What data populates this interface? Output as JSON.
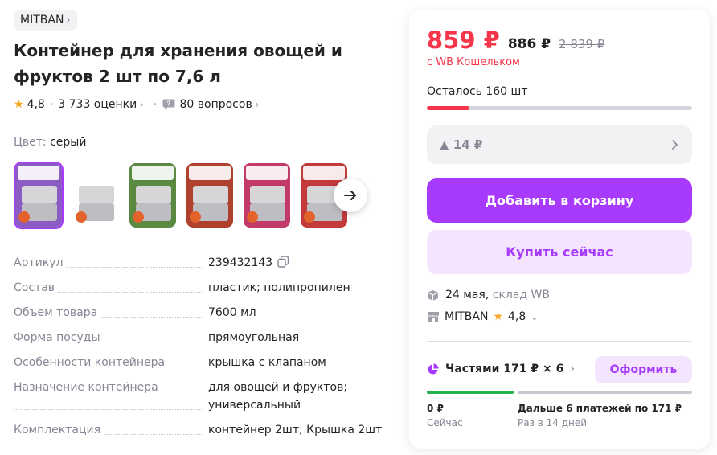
{
  "product": {
    "brand": "MITBAN",
    "title": "Контейнер для хранения овощей и фруктов 2 шт по 7,6 л",
    "rating": "4,8",
    "reviews": "3 733 оценки",
    "questions": "80 вопросов",
    "color_label": "Цвет:",
    "color_value": "серый",
    "thumbnails": [
      {
        "icon": "product-photo",
        "selected": true,
        "bg": "#8a5cc4"
      },
      {
        "icon": "product-photo",
        "selected": false,
        "bg": "#ffffff"
      },
      {
        "icon": "product-photo",
        "selected": false,
        "bg": "#5a8a42"
      },
      {
        "icon": "product-photo",
        "selected": false,
        "bg": "#b0402e"
      },
      {
        "icon": "product-photo",
        "selected": false,
        "bg": "#c23a6a"
      },
      {
        "icon": "product-photo",
        "selected": false,
        "bg": "#c23a3a"
      }
    ],
    "specs": [
      {
        "key": "Артикул",
        "value": "239432143",
        "copy": true
      },
      {
        "key": "Состав",
        "value": "пластик; полипропилен"
      },
      {
        "key": "Объем товара",
        "value": "7600 мл"
      },
      {
        "key": "Форма посуды",
        "value": "прямоугольная"
      },
      {
        "key": "Особенности контейнера",
        "value": "крышка с клапаном"
      },
      {
        "key": "Назначение контейнера",
        "value": "для овощей и фруктов; универсальный"
      },
      {
        "key": "Комплектация",
        "value": "контейнер 2шт; Крышка 2шт"
      }
    ]
  },
  "buy_card": {
    "price": "859 ₽",
    "price_regular": "886 ₽",
    "price_old": "2 839 ₽",
    "wallet_note": "с WB Кошельком",
    "stock_left": "Осталось 160 шт",
    "stock_fraction": 0.16,
    "price_delta": "▲ 14 ₽",
    "add_to_cart": "Добавить в корзину",
    "buy_now": "Купить сейчас",
    "delivery_date": "24 мая,",
    "delivery_place": "склад WB",
    "seller_name": "MITBAN",
    "seller_rating": "4,8",
    "installments": "Частями 171 ₽ × 6",
    "apply": "Оформить",
    "pay_now_amount": "0 ₽",
    "pay_now_label": "Сейчас",
    "pay_later_amount": "Дальше 6 платежей по 171 ₽",
    "pay_later_label": "Раз в 14 дней",
    "colors": {
      "accent": "#a73afd",
      "price": "#f6354a",
      "green": "#22b24c"
    }
  }
}
